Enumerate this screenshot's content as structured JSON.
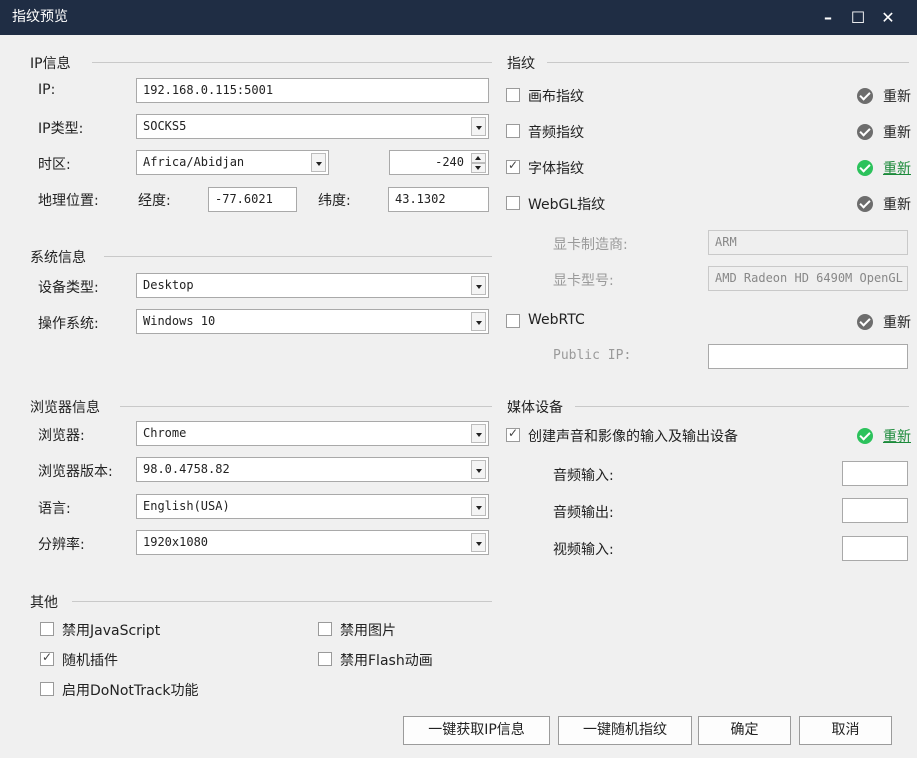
{
  "window": {
    "title": "指纹预览",
    "minimize_icon": "minimize-icon",
    "maximize_icon": "maximize-icon",
    "close_icon": "close-icon"
  },
  "ip_info": {
    "section_title": "IP信息",
    "ip_label": "IP:",
    "ip_value": "192.168.0.115:5001",
    "ip_type_label": "IP类型:",
    "ip_type_value": "SOCKS5",
    "timezone_label": "时区:",
    "timezone_value": "Africa/Abidjan",
    "timezone_offset": "-240",
    "geo_label": "地理位置:",
    "lon_label": "经度:",
    "lon_value": "-77.6021",
    "lat_label": "纬度:",
    "lat_value": "43.1302"
  },
  "system_info": {
    "section_title": "系统信息",
    "device_type_label": "设备类型:",
    "device_type_value": "Desktop",
    "os_label": "操作系统:",
    "os_value": "Windows 10"
  },
  "browser_info": {
    "section_title": "浏览器信息",
    "browser_label": "浏览器:",
    "browser_value": "Chrome",
    "version_label": "浏览器版本:",
    "version_value": "98.0.4758.82",
    "language_label": "语言:",
    "language_value": "English(USA)",
    "resolution_label": "分辨率:",
    "resolution_value": "1920x1080"
  },
  "other": {
    "section_title": "其他",
    "disable_js": {
      "label": "禁用JavaScript",
      "checked": false
    },
    "disable_images": {
      "label": "禁用图片",
      "checked": false
    },
    "random_plugins": {
      "label": "随机插件",
      "checked": true
    },
    "disable_flash": {
      "label": "禁用Flash动画",
      "checked": false
    },
    "do_not_track": {
      "label": "启用DoNotTrack功能",
      "checked": false
    }
  },
  "fingerprint": {
    "section_title": "指纹",
    "canvas": {
      "label": "画布指纹",
      "checked": false,
      "reset": "重新"
    },
    "audio": {
      "label": "音频指纹",
      "checked": false,
      "reset": "重新"
    },
    "font": {
      "label": "字体指纹",
      "checked": true,
      "reset": "重新"
    },
    "webgl": {
      "label": "WebGL指纹",
      "checked": false,
      "reset": "重新"
    },
    "gpu_vendor_label": "显卡制造商:",
    "gpu_vendor_value": "ARM",
    "gpu_model_label": "显卡型号:",
    "gpu_model_value": "AMD Radeon HD 6490M OpenGL",
    "webrtc": {
      "label": "WebRTC",
      "checked": false,
      "reset": "重新"
    },
    "public_ip_label": "Public IP:",
    "public_ip_value": ""
  },
  "media": {
    "section_title": "媒体设备",
    "create_devices": {
      "label": "创建声音和影像的输入及输出设备",
      "checked": true,
      "reset": "重新"
    },
    "audio_in_label": "音频输入:",
    "audio_out_label": "音频输出:",
    "video_in_label": "视频输入:"
  },
  "buttons": {
    "get_ip": "一键获取IP信息",
    "random_fp": "一键随机指纹",
    "ok": "确定",
    "cancel": "取消"
  },
  "colors": {
    "titlebar": "#1f2d44",
    "status_ok": "#2cc25c",
    "status_default": "#6d6d6d",
    "link": "#1b8a3a"
  }
}
